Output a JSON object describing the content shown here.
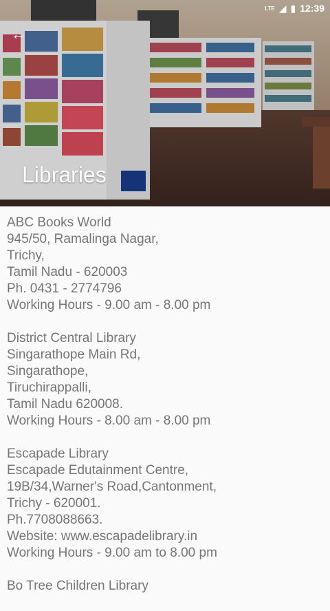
{
  "status": {
    "network": "LTE",
    "time": "12:39"
  },
  "header": {
    "title": "Libraries",
    "back_icon": "arrow-left-icon"
  },
  "libraries": [
    {
      "lines": [
        "ABC Books World",
        "945/50, Ramalinga Nagar,",
        "Trichy,",
        "Tamil Nadu - 620003",
        "Ph. 0431 - 2774796",
        "Working Hours - 9.00 am - 8.00 pm"
      ]
    },
    {
      "lines": [
        "District Central Library",
        "Singarathope Main Rd,",
        "Singarathope,",
        "Tiruchirappalli,",
        "Tamil Nadu 620008.",
        "Working Hours - 8.00 am - 8.00 pm"
      ]
    },
    {
      "lines": [
        "Escapade Library",
        "Escapade Edutainment Centre,",
        "19B/34,Warner's Road,Cantonment,",
        "Trichy - 620001.",
        "Ph.7708088663.",
        "Website: www.escapadelibrary.in",
        "Working Hours - 9.00 am to 8.00 pm"
      ]
    },
    {
      "lines": [
        "Bo Tree Children Library"
      ]
    }
  ]
}
